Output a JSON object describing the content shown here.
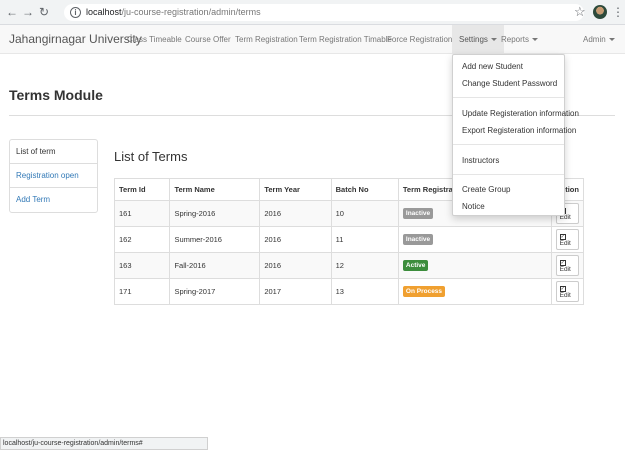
{
  "browser": {
    "url_host": "localhost",
    "url_path": "/ju-course-registration/admin/terms"
  },
  "navbar": {
    "brand": "Jahangirnagar University",
    "items": [
      "Class Timeable",
      "Course Offer",
      "Term Registration",
      "Term Registration Timable"
    ],
    "force_registration": "Force Registration",
    "settings": "Settings",
    "reports": "Reports",
    "admin": "Admin"
  },
  "settings_menu": {
    "items": [
      "Add new Student",
      "Change Student Password",
      "Update Registeration information",
      "Export Registeration information",
      "Instructors",
      "Create Group",
      "Notice"
    ]
  },
  "page": {
    "title": "Terms Module"
  },
  "sidebar": {
    "items": [
      "List of term",
      "Registration open",
      "Add Term"
    ]
  },
  "main": {
    "title": "List of Terms",
    "columns": [
      "Term Id",
      "Term Name",
      "Term Year",
      "Batch No",
      "Term Registratio",
      "Action"
    ],
    "rows": [
      {
        "id": "161",
        "name": "Spring-2016",
        "year": "2016",
        "batch": "10",
        "status": "Inactive",
        "action": "Edit"
      },
      {
        "id": "162",
        "name": "Summer-2016",
        "year": "2016",
        "batch": "11",
        "status": "Inactive",
        "action": "Edit"
      },
      {
        "id": "163",
        "name": "Fall-2016",
        "year": "2016",
        "batch": "12",
        "status": "Active",
        "action": "Edit"
      },
      {
        "id": "171",
        "name": "Spring-2017",
        "year": "2017",
        "batch": "13",
        "status": "On Process",
        "action": "Edit"
      }
    ]
  },
  "status_colors": {
    "Inactive": "#999999",
    "Active": "#3c8d3c",
    "On Process": "#f0a030"
  },
  "statusbar": {
    "text": "localhost/ju-course-registration/admin/terms#"
  }
}
